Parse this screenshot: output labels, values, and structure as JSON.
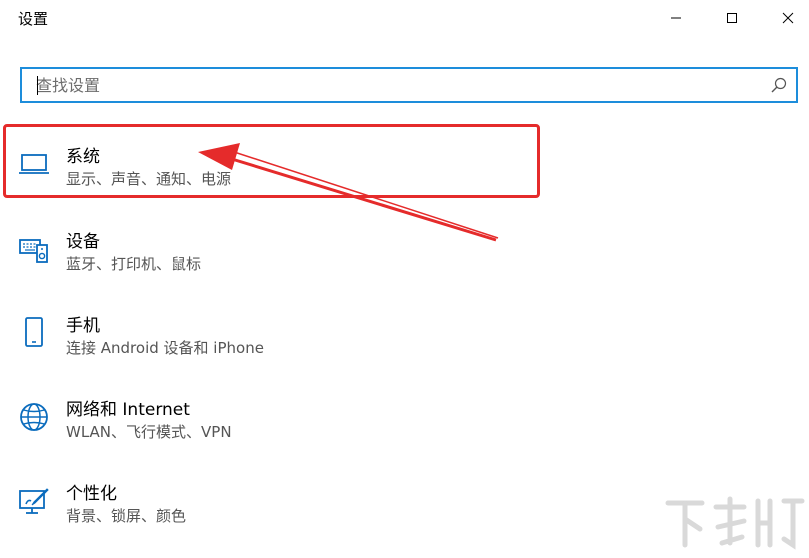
{
  "window": {
    "title": "设置"
  },
  "search": {
    "placeholder": "查找设置",
    "value": ""
  },
  "items": [
    {
      "title": "系统",
      "subtitle": "显示、声音、通知、电源",
      "icon": "laptop-icon"
    },
    {
      "title": "设备",
      "subtitle": "蓝牙、打印机、鼠标",
      "icon": "devices-icon"
    },
    {
      "title": "手机",
      "subtitle": "连接 Android 设备和 iPhone",
      "icon": "phone-icon"
    },
    {
      "title": "网络和 Internet",
      "subtitle": "WLAN、飞行模式、VPN",
      "icon": "globe-icon"
    },
    {
      "title": "个性化",
      "subtitle": "背景、锁屏、颜色",
      "icon": "personalization-icon"
    }
  ],
  "colors": {
    "accent": "#1d8ddb",
    "annotation": "#e52b2b",
    "icon": "#0b6cbd"
  }
}
